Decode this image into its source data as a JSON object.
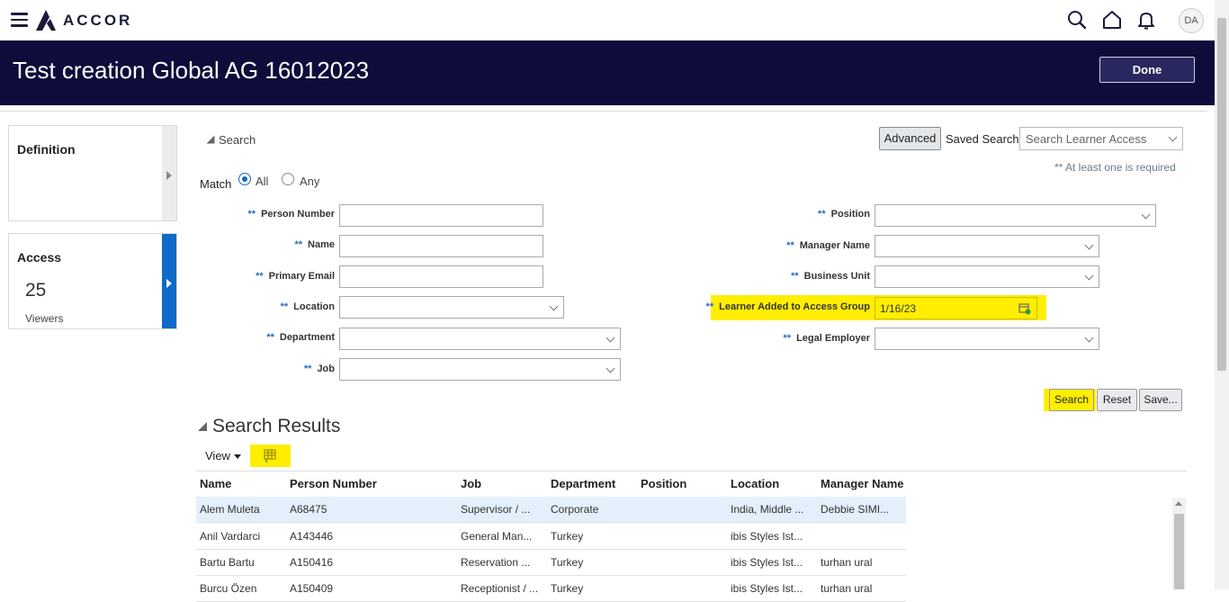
{
  "topbar": {
    "brand": "ACCOR",
    "avatar_initials": "DA",
    "icons": [
      "search-icon",
      "home-icon",
      "bell-icon"
    ]
  },
  "header": {
    "title": "Test creation Global AG 16012023",
    "done_label": "Done"
  },
  "sidebar": {
    "definition": {
      "title": "Definition"
    },
    "access": {
      "title": "Access",
      "count": "25",
      "subtitle": "Viewers"
    }
  },
  "search": {
    "toggle_label": "Search",
    "advanced_label": "Advanced",
    "saved_search_label": "Saved Search",
    "saved_search_placeholder": "Search Learner Access",
    "required_note": "** At least one is required",
    "match_label": "Match",
    "match_options": [
      "All",
      "Any"
    ],
    "match_selected": "All",
    "required_marker": "**",
    "fields": {
      "person_number": {
        "label": "Person Number",
        "value": ""
      },
      "name": {
        "label": "Name",
        "value": ""
      },
      "primary_email": {
        "label": "Primary Email",
        "value": ""
      },
      "location": {
        "label": "Location",
        "value": ""
      },
      "department": {
        "label": "Department",
        "value": ""
      },
      "job": {
        "label": "Job",
        "value": ""
      },
      "position": {
        "label": "Position",
        "value": ""
      },
      "manager_name": {
        "label": "Manager Name",
        "value": ""
      },
      "business_unit": {
        "label": "Business Unit",
        "value": ""
      },
      "learner_added": {
        "label": "Learner Added to Access Group",
        "value": "1/16/23"
      },
      "legal_employer": {
        "label": "Legal Employer",
        "value": ""
      }
    },
    "buttons": {
      "search": "Search",
      "reset": "Reset",
      "save": "Save..."
    }
  },
  "results": {
    "title": "Search Results",
    "view_label": "View",
    "columns": [
      "Name",
      "Person Number",
      "Job",
      "Department",
      "Position",
      "Location",
      "Manager Name"
    ],
    "rows": [
      [
        "Alem Muleta",
        "A68475",
        "Supervisor / ...",
        "Corporate",
        "",
        "India, Middle ...",
        "Debbie SIMI..."
      ],
      [
        "Anil Vardarci",
        "A143446",
        "General Man...",
        "Turkey",
        "",
        "ibis Styles Ist...",
        ""
      ],
      [
        "Bartu Bartu",
        "A150416",
        "Reservation ...",
        "Turkey",
        "",
        "ibis Styles Ist...",
        "turhan ural"
      ],
      [
        "Burcu Özen",
        "A150409",
        "Receptionist / ...",
        "Turkey",
        "",
        "ibis Styles Ist...",
        "turhan ural"
      ]
    ]
  },
  "colors": {
    "header_bg": "#0e0c3b",
    "accent": "#0f6ac8",
    "highlight": "#ffee00"
  }
}
